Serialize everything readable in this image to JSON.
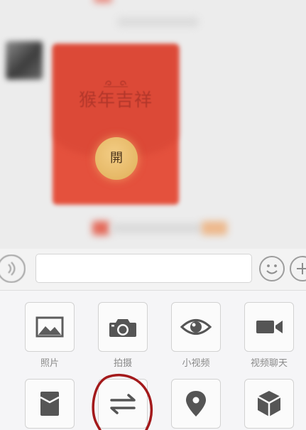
{
  "chat": {
    "red_packet": {
      "greeting": "猴年吉祥",
      "open_label": "開",
      "color": "#e4513d",
      "open_button_color": "#e6b866"
    }
  },
  "input_bar": {
    "message_value": "",
    "voice_icon": "voice-icon",
    "emoji_icon": "emoji-icon",
    "more_icon": "plus-icon"
  },
  "panel": {
    "items": [
      {
        "label": "照片",
        "icon": "photo-icon"
      },
      {
        "label": "拍摄",
        "icon": "camera-icon"
      },
      {
        "label": "小视频",
        "icon": "eye-icon"
      },
      {
        "label": "视频聊天",
        "icon": "video-camera-icon"
      },
      {
        "icon": "red-packet-icon"
      },
      {
        "icon": "transfer-icon"
      },
      {
        "icon": "location-pin-icon"
      },
      {
        "icon": "cube-icon"
      }
    ]
  },
  "annotation": {
    "color": "#a3191b"
  }
}
